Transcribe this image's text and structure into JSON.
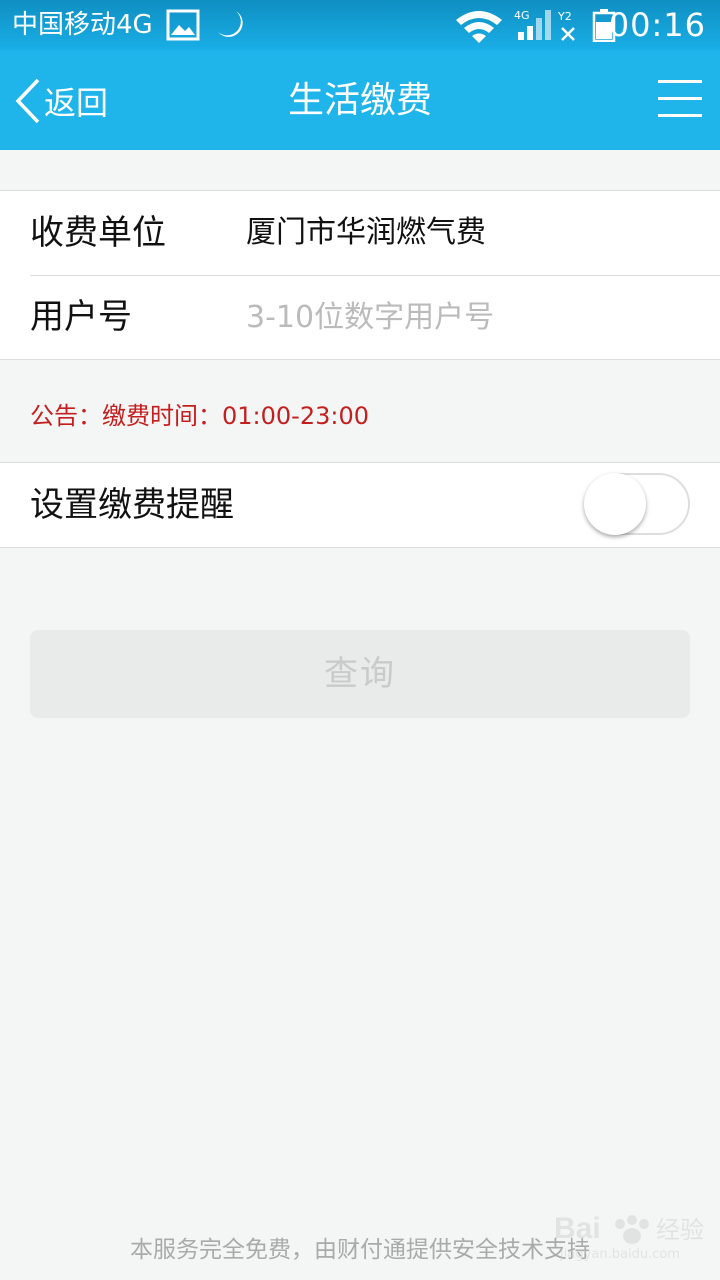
{
  "status_bar": {
    "carrier": "中国移动4G",
    "time": "00:16",
    "icons": [
      "image-icon",
      "moon-icon",
      "wifi-icon",
      "signal-4g-icon",
      "no-sim-icon",
      "battery-icon"
    ],
    "network_label": "4G",
    "sim_label": "Y2"
  },
  "nav": {
    "back_label": "返回",
    "title": "生活缴费",
    "menu_icon": "menu-icon"
  },
  "form": {
    "payee_label": "收费单位",
    "payee_value": "厦门市华润燃气费",
    "account_label": "用户号",
    "account_value": "",
    "account_placeholder": "3-10位数字用户号"
  },
  "notice": "公告：缴费时间：01:00-23:00",
  "reminder": {
    "label": "设置缴费提醒",
    "enabled": false
  },
  "query_button": "查询",
  "footer": "本服务完全免费，由财付通提供安全技术支持",
  "watermark": {
    "text": "Bai",
    "text2": "经验",
    "url": "jingyan.baidu.com"
  },
  "colors": {
    "header": "#1fb4ea",
    "notice": "#c41f1f",
    "button_disabled": "#e9ebea"
  }
}
